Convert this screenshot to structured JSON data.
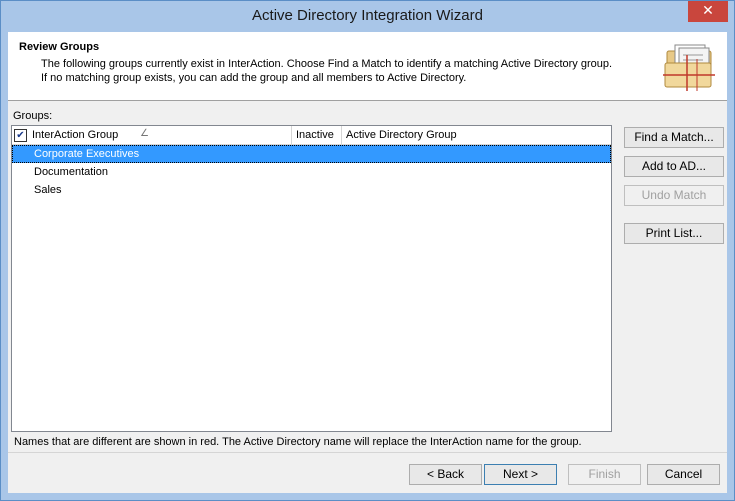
{
  "window": {
    "title": "Active Directory Integration Wizard",
    "close_glyph": "✕"
  },
  "header": {
    "title": "Review Groups",
    "desc_line1": "The following groups currently exist in InterAction. Choose Find a Match to identify a matching Active Directory group.",
    "desc_line2": "If no matching group exists, you can add the group and all members to Active Directory.",
    "icon": "folder-documents-icon"
  },
  "groups_label": "Groups:",
  "listview": {
    "columns": [
      "InterAction Group",
      "Inactive",
      "Active Directory Group"
    ],
    "check_glyph": "✔",
    "sort_glyph": "∠",
    "rows": [
      {
        "group": "Corporate Executives",
        "inactive": "",
        "ad_group": "",
        "selected": true
      },
      {
        "group": "Documentation",
        "inactive": "",
        "ad_group": "",
        "selected": false
      },
      {
        "group": "Sales",
        "inactive": "",
        "ad_group": "",
        "selected": false
      }
    ]
  },
  "side_buttons": {
    "find_match": "Find a Match...",
    "add_to_ad": "Add to AD...",
    "undo_match": "Undo Match",
    "print_list": "Print List..."
  },
  "note": "Names that are different are shown in red. The Active Directory name will replace the InterAction name for the group.",
  "nav_buttons": {
    "back": "< Back",
    "next": "Next >",
    "finish": "Finish",
    "cancel": "Cancel"
  }
}
